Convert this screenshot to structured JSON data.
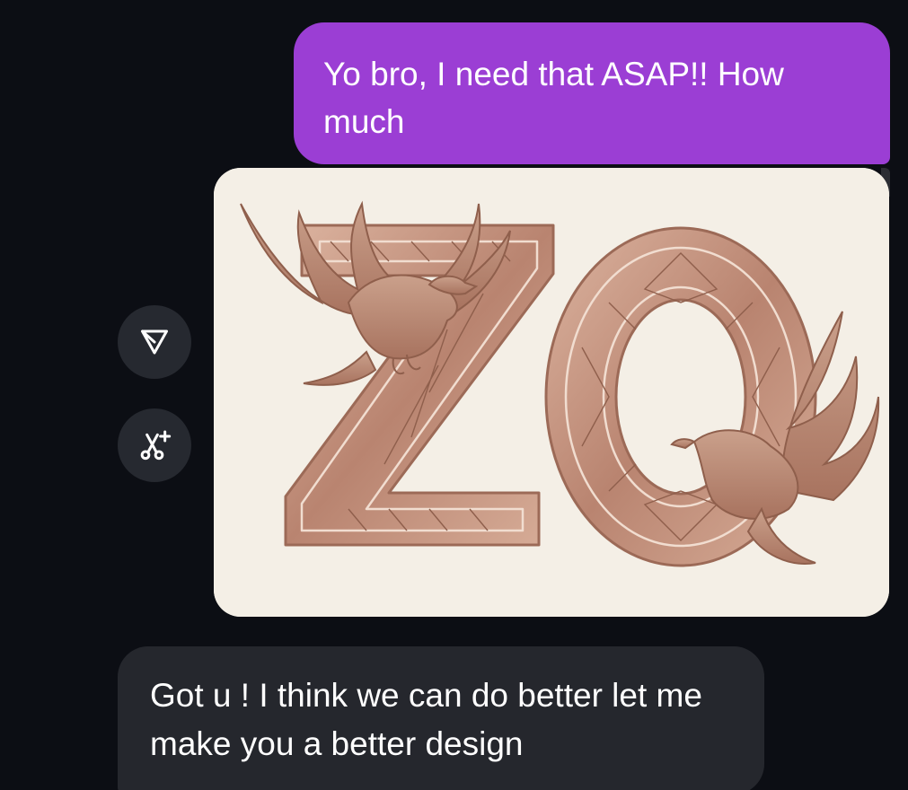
{
  "conversation": {
    "outgoing_message": {
      "text": "Yo bro, I need that ASAP!! How much"
    },
    "image_message": {
      "logo_text": "ZO",
      "accent_color": "#c0907a"
    },
    "actions": {
      "share_icon": "send-plane-icon",
      "remix_icon": "scissors-sparkle-icon"
    },
    "incoming_message": {
      "text": "Got u ! I think we can do better let me make you a better design"
    }
  },
  "colors": {
    "background": "#0c0e14",
    "outgoing_bubble": "#9b3ed4",
    "incoming_bubble": "#25272d",
    "action_button": "#262930"
  }
}
